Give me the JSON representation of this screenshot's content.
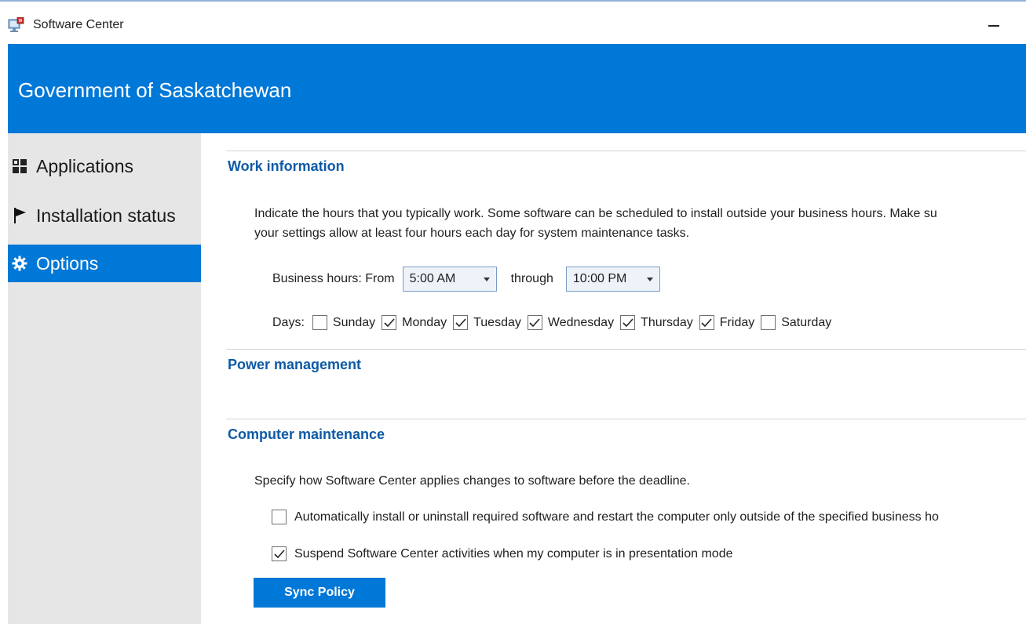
{
  "window": {
    "title": "Software Center",
    "app_icon": "software-center-icon",
    "minimize_icon": "minimize-icon"
  },
  "banner": {
    "title": "Government of Saskatchewan",
    "color": "#0078d7"
  },
  "sidebar": {
    "items": [
      {
        "label": "Applications",
        "icon": "grid-icon",
        "active": false
      },
      {
        "label": "Installation status",
        "icon": "flag-icon",
        "active": false
      },
      {
        "label": "Options",
        "icon": "gear-icon",
        "active": true
      }
    ]
  },
  "work": {
    "title": "Work information",
    "description_line1": "Indicate the hours that you typically work. Some software can be scheduled to install outside your business hours. Make su",
    "description_line2": "your settings allow at least four hours each day for system maintenance tasks.",
    "hours_label": "Business hours: From",
    "from_value": "5:00 AM",
    "through_label": "through",
    "to_value": "10:00 PM",
    "days_label": "Days:",
    "days": [
      {
        "label": "Sunday",
        "checked": false
      },
      {
        "label": "Monday",
        "checked": true
      },
      {
        "label": "Tuesday",
        "checked": true
      },
      {
        "label": "Wednesday",
        "checked": true
      },
      {
        "label": "Thursday",
        "checked": true
      },
      {
        "label": "Friday",
        "checked": true
      },
      {
        "label": "Saturday",
        "checked": false
      }
    ]
  },
  "power": {
    "title": "Power management"
  },
  "maintenance": {
    "title": "Computer maintenance",
    "description": "Specify how Software Center applies changes to software before the deadline.",
    "option1": {
      "label": "Automatically install or uninstall required software and restart the computer only outside of the specified business ho",
      "checked": false
    },
    "option2": {
      "label": "Suspend Software Center activities when my computer is in presentation mode",
      "checked": true
    },
    "sync_label": "Sync Policy"
  }
}
